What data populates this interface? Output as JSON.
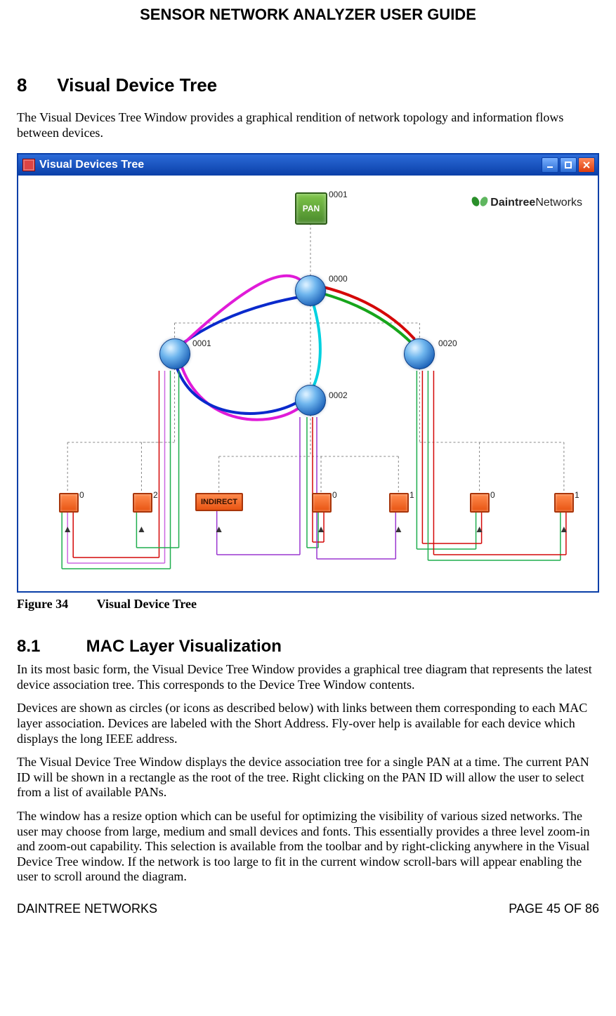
{
  "header_title": "SENSOR NETWORK ANALYZER USER GUIDE",
  "section": {
    "num": "8",
    "title": "Visual Device Tree"
  },
  "intro_para": "The Visual Devices Tree Window provides a graphical rendition of network topology and information flows between devices.",
  "window": {
    "title": "Visual Devices Tree",
    "logo_brand_bold": "Daintree",
    "logo_brand_light": "Networks",
    "pan": {
      "label": "PAN",
      "id_label": "0001"
    },
    "nodes": {
      "top": {
        "label": "0000"
      },
      "left": {
        "label": "0001"
      },
      "right": {
        "label": "0020"
      },
      "bottom": {
        "label": "0002"
      }
    },
    "end_devices": [
      {
        "label": "0"
      },
      {
        "label": "2"
      },
      {
        "label": "0"
      },
      {
        "label": "1"
      },
      {
        "label": "0"
      },
      {
        "label": "1"
      }
    ],
    "indirect_label": "INDIRECT"
  },
  "figure": {
    "label": "Figure 34",
    "title": "Visual Device Tree"
  },
  "subsection": {
    "num": "8.1",
    "title": "MAC Layer Visualization"
  },
  "body_paras": [
    "In its most basic form, the Visual Device Tree Window provides a graphical tree diagram that represents the latest device association tree. This corresponds to the Device Tree Window contents.",
    "Devices are shown as circles (or icons as described below) with links between them corresponding to each MAC layer association. Devices are labeled with the Short Address. Fly-over help is available for each device which displays the long IEEE address.",
    "The Visual Device Tree Window displays the device association tree for a single PAN at a time. The current PAN ID will be shown in a rectangle as the root of the tree. Right clicking on the PAN ID will allow the user to select from a list of available PANs.",
    "The window has a resize option which can be useful for optimizing the visibility of various sized networks. The user may choose from large, medium and small devices and fonts.  This essentially provides a three level zoom-in and zoom-out capability. This selection is available from the toolbar and by right-clicking anywhere in the Visual Device Tree window. If the network is too large to fit in the current window scroll-bars will appear enabling the user to scroll around the diagram."
  ],
  "footer": {
    "left": "DAINTREE NETWORKS",
    "right": "PAGE 45 OF 86"
  },
  "chart_data": {
    "type": "diagram",
    "title": "Visual Devices Tree",
    "root": {
      "kind": "PAN",
      "id": "0001"
    },
    "routers": [
      {
        "id": "0000",
        "parent": "PAN:0001"
      },
      {
        "id": "0001",
        "parent": "0000"
      },
      {
        "id": "0020",
        "parent": "0000"
      },
      {
        "id": "0002",
        "parent": "0000"
      }
    ],
    "end_devices": [
      {
        "label": "0",
        "parent": "0001"
      },
      {
        "label": "2",
        "parent": "0001"
      },
      {
        "label": "INDIRECT",
        "parent": "0002"
      },
      {
        "label": "0",
        "parent": "0002"
      },
      {
        "label": "1",
        "parent": "0002"
      },
      {
        "label": "0",
        "parent": "0020"
      },
      {
        "label": "1",
        "parent": "0020"
      }
    ],
    "traffic_arcs": [
      {
        "from": "0000",
        "to": "0001",
        "colors": [
          "blue",
          "magenta"
        ]
      },
      {
        "from": "0000",
        "to": "0020",
        "colors": [
          "green",
          "red"
        ]
      },
      {
        "from": "0000",
        "to": "0002",
        "colors": [
          "cyan"
        ]
      },
      {
        "from": "0001",
        "to": "0002",
        "colors": [
          "magenta",
          "blue"
        ]
      }
    ],
    "logo": "DaintreeNetworks"
  }
}
